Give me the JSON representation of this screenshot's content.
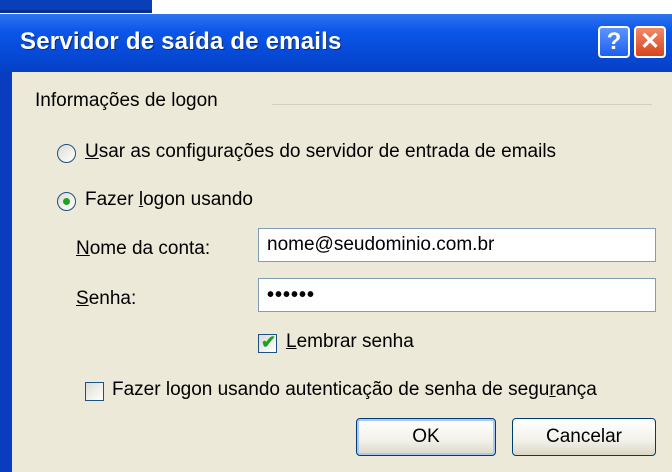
{
  "window": {
    "title": "Servidor de saída de emails",
    "help_glyph": "?",
    "close_glyph": "✕"
  },
  "logon": {
    "group_label": "Informações de logon",
    "option_incoming": {
      "accel": "U",
      "rest": "sar as configurações do servidor de entrada de emails",
      "selected": false
    },
    "option_logon": {
      "pre": "Fazer ",
      "accel": "l",
      "post": "ogon usando",
      "selected": true
    },
    "account": {
      "accel": "N",
      "rest": "ome da conta:",
      "value": "nome@seudominio.com.br"
    },
    "password": {
      "accel": "S",
      "rest": "enha:",
      "value": "••••••"
    },
    "remember": {
      "accel": "L",
      "rest": "embrar senha",
      "checked": true
    },
    "spa": {
      "pre": "Fazer logon usando autenticação de senha de segu",
      "accel": "r",
      "post": "ança",
      "checked": false
    }
  },
  "buttons": {
    "ok": "OK",
    "cancel": "Cancelar"
  },
  "colors": {
    "titlebar": "#0a56e8",
    "client": "#ece9d8",
    "radio_dot": "#21a121",
    "close": "#d8431c"
  }
}
